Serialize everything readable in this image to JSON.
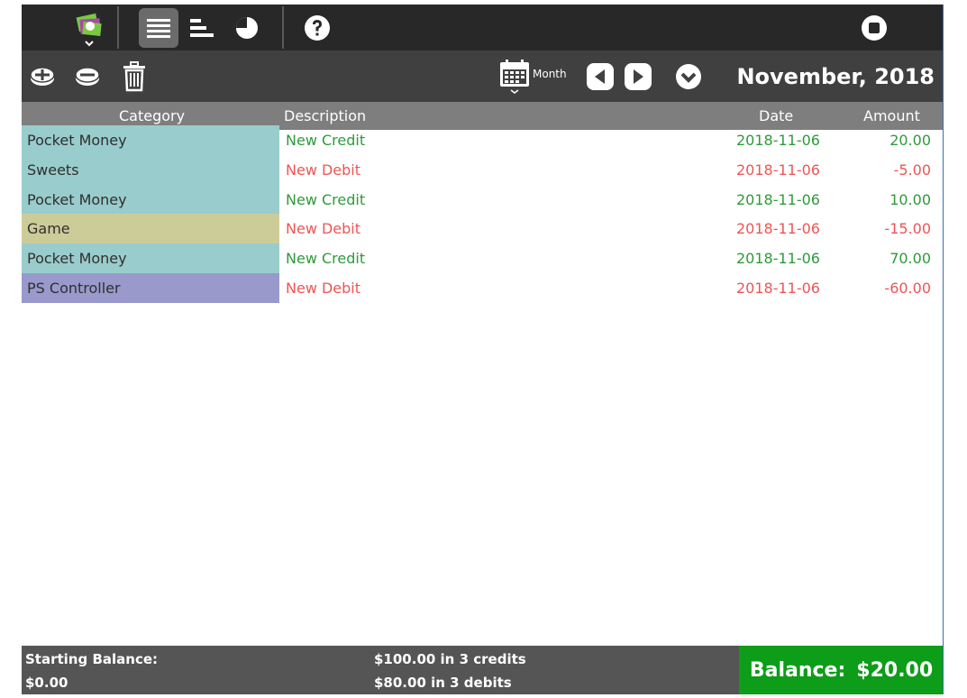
{
  "toolbar": {
    "icons": [
      "money-app-icon",
      "list-view-icon",
      "bar-chart-icon",
      "pie-chart-icon",
      "help-icon",
      "stop-icon"
    ]
  },
  "subtoolbar": {
    "period_label": "Month",
    "current_period": "November, 2018"
  },
  "table": {
    "headers": {
      "category": "Category",
      "description": "Description",
      "date": "Date",
      "amount": "Amount"
    },
    "rows": [
      {
        "category": "Pocket Money",
        "description": "New Credit",
        "date": "2018-11-06",
        "amount": "20.00",
        "type": "credit",
        "cat_color": "#99cccc"
      },
      {
        "category": "Sweets",
        "description": "New Debit",
        "date": "2018-11-06",
        "amount": "-5.00",
        "type": "debit",
        "cat_color": "#99cccc"
      },
      {
        "category": "Pocket Money",
        "description": "New Credit",
        "date": "2018-11-06",
        "amount": "10.00",
        "type": "credit",
        "cat_color": "#99cccc"
      },
      {
        "category": "Game",
        "description": "New Debit",
        "date": "2018-11-06",
        "amount": "-15.00",
        "type": "debit",
        "cat_color": "#cccc99"
      },
      {
        "category": "Pocket Money",
        "description": "New Credit",
        "date": "2018-11-06",
        "amount": "70.00",
        "type": "credit",
        "cat_color": "#99cccc"
      },
      {
        "category": "PS Controller",
        "description": "New Debit",
        "date": "2018-11-06",
        "amount": "-60.00",
        "type": "debit",
        "cat_color": "#9999cc"
      }
    ]
  },
  "footer": {
    "starting_label": "Starting Balance:",
    "starting_value": "$0.00",
    "credits_summary": "$100.00 in 3 credits",
    "debits_summary": "$80.00 in 3 debits",
    "balance_label": "Balance:",
    "balance_value": "$20.00"
  },
  "colors": {
    "credit": "#2e9a3a",
    "debit": "#ee5555",
    "balance_bg": "#0d9d18"
  }
}
